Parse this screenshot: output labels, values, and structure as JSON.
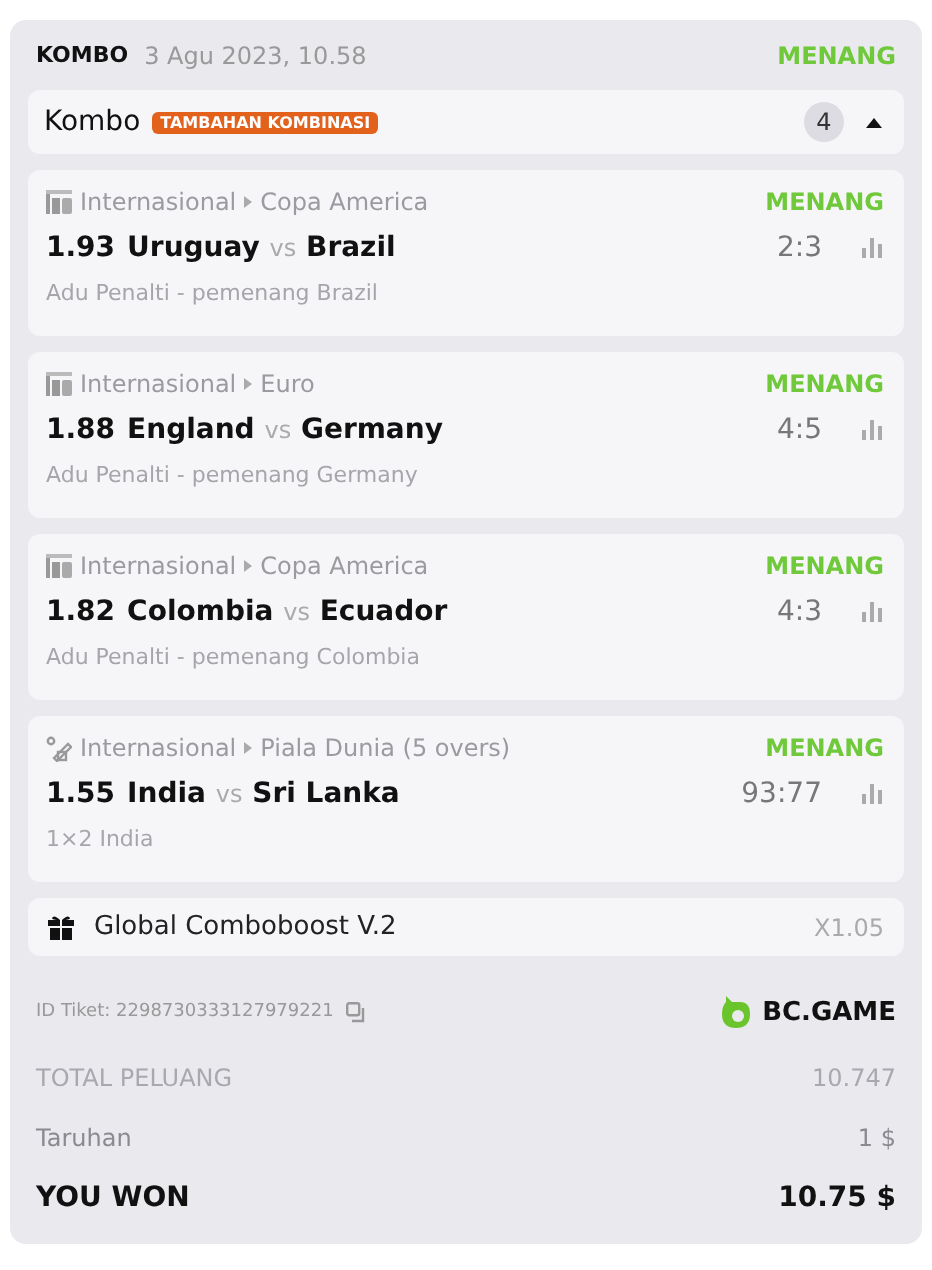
{
  "header": {
    "type": "KOMBO",
    "date": "3 Agu 2023, 10.58",
    "status": "MENANG"
  },
  "combo": {
    "title": "Kombo",
    "badge": "TAMBAHAN KOMBINASI",
    "count": "4",
    "expanded": true
  },
  "legs": [
    {
      "kind": "esoccer",
      "category": "Internasional",
      "league": "Copa America",
      "status": "MENANG",
      "odds": "1.93",
      "home": "Uruguay",
      "vs": "vs",
      "away": "Brazil",
      "score": "2:3",
      "market": "Adu Penalti - pemenang Brazil"
    },
    {
      "kind": "esoccer",
      "category": "Internasional",
      "league": "Euro",
      "status": "MENANG",
      "odds": "1.88",
      "home": "England",
      "vs": "vs",
      "away": "Germany",
      "score": "4:5",
      "market": "Adu Penalti - pemenang Germany"
    },
    {
      "kind": "esoccer",
      "category": "Internasional",
      "league": "Copa America",
      "status": "MENANG",
      "odds": "1.82",
      "home": "Colombia",
      "vs": "vs",
      "away": "Ecuador",
      "score": "4:3",
      "market": "Adu Penalti - pemenang Colombia"
    },
    {
      "kind": "cricket",
      "category": "Internasional",
      "league": "Piala Dunia (5 overs)",
      "status": "MENANG",
      "odds": "1.55",
      "home": "India",
      "vs": "vs",
      "away": "Sri Lanka",
      "score": "93:77",
      "market": "1×2 India"
    }
  ],
  "boost": {
    "name": "Global Comboboost V.2",
    "multiplier": "X1.05"
  },
  "ticket": {
    "id": "ID Tiket: 2298730333127979221",
    "logo": "BC.GAME"
  },
  "totals": [
    {
      "kind": "muted",
      "label": "TOTAL PELUANG",
      "value": "10.747"
    },
    {
      "kind": "normal",
      "label": "Taruhan",
      "value": "1 $"
    },
    {
      "kind": "strong",
      "label": "YOU WON",
      "value": "10.75 $"
    }
  ]
}
